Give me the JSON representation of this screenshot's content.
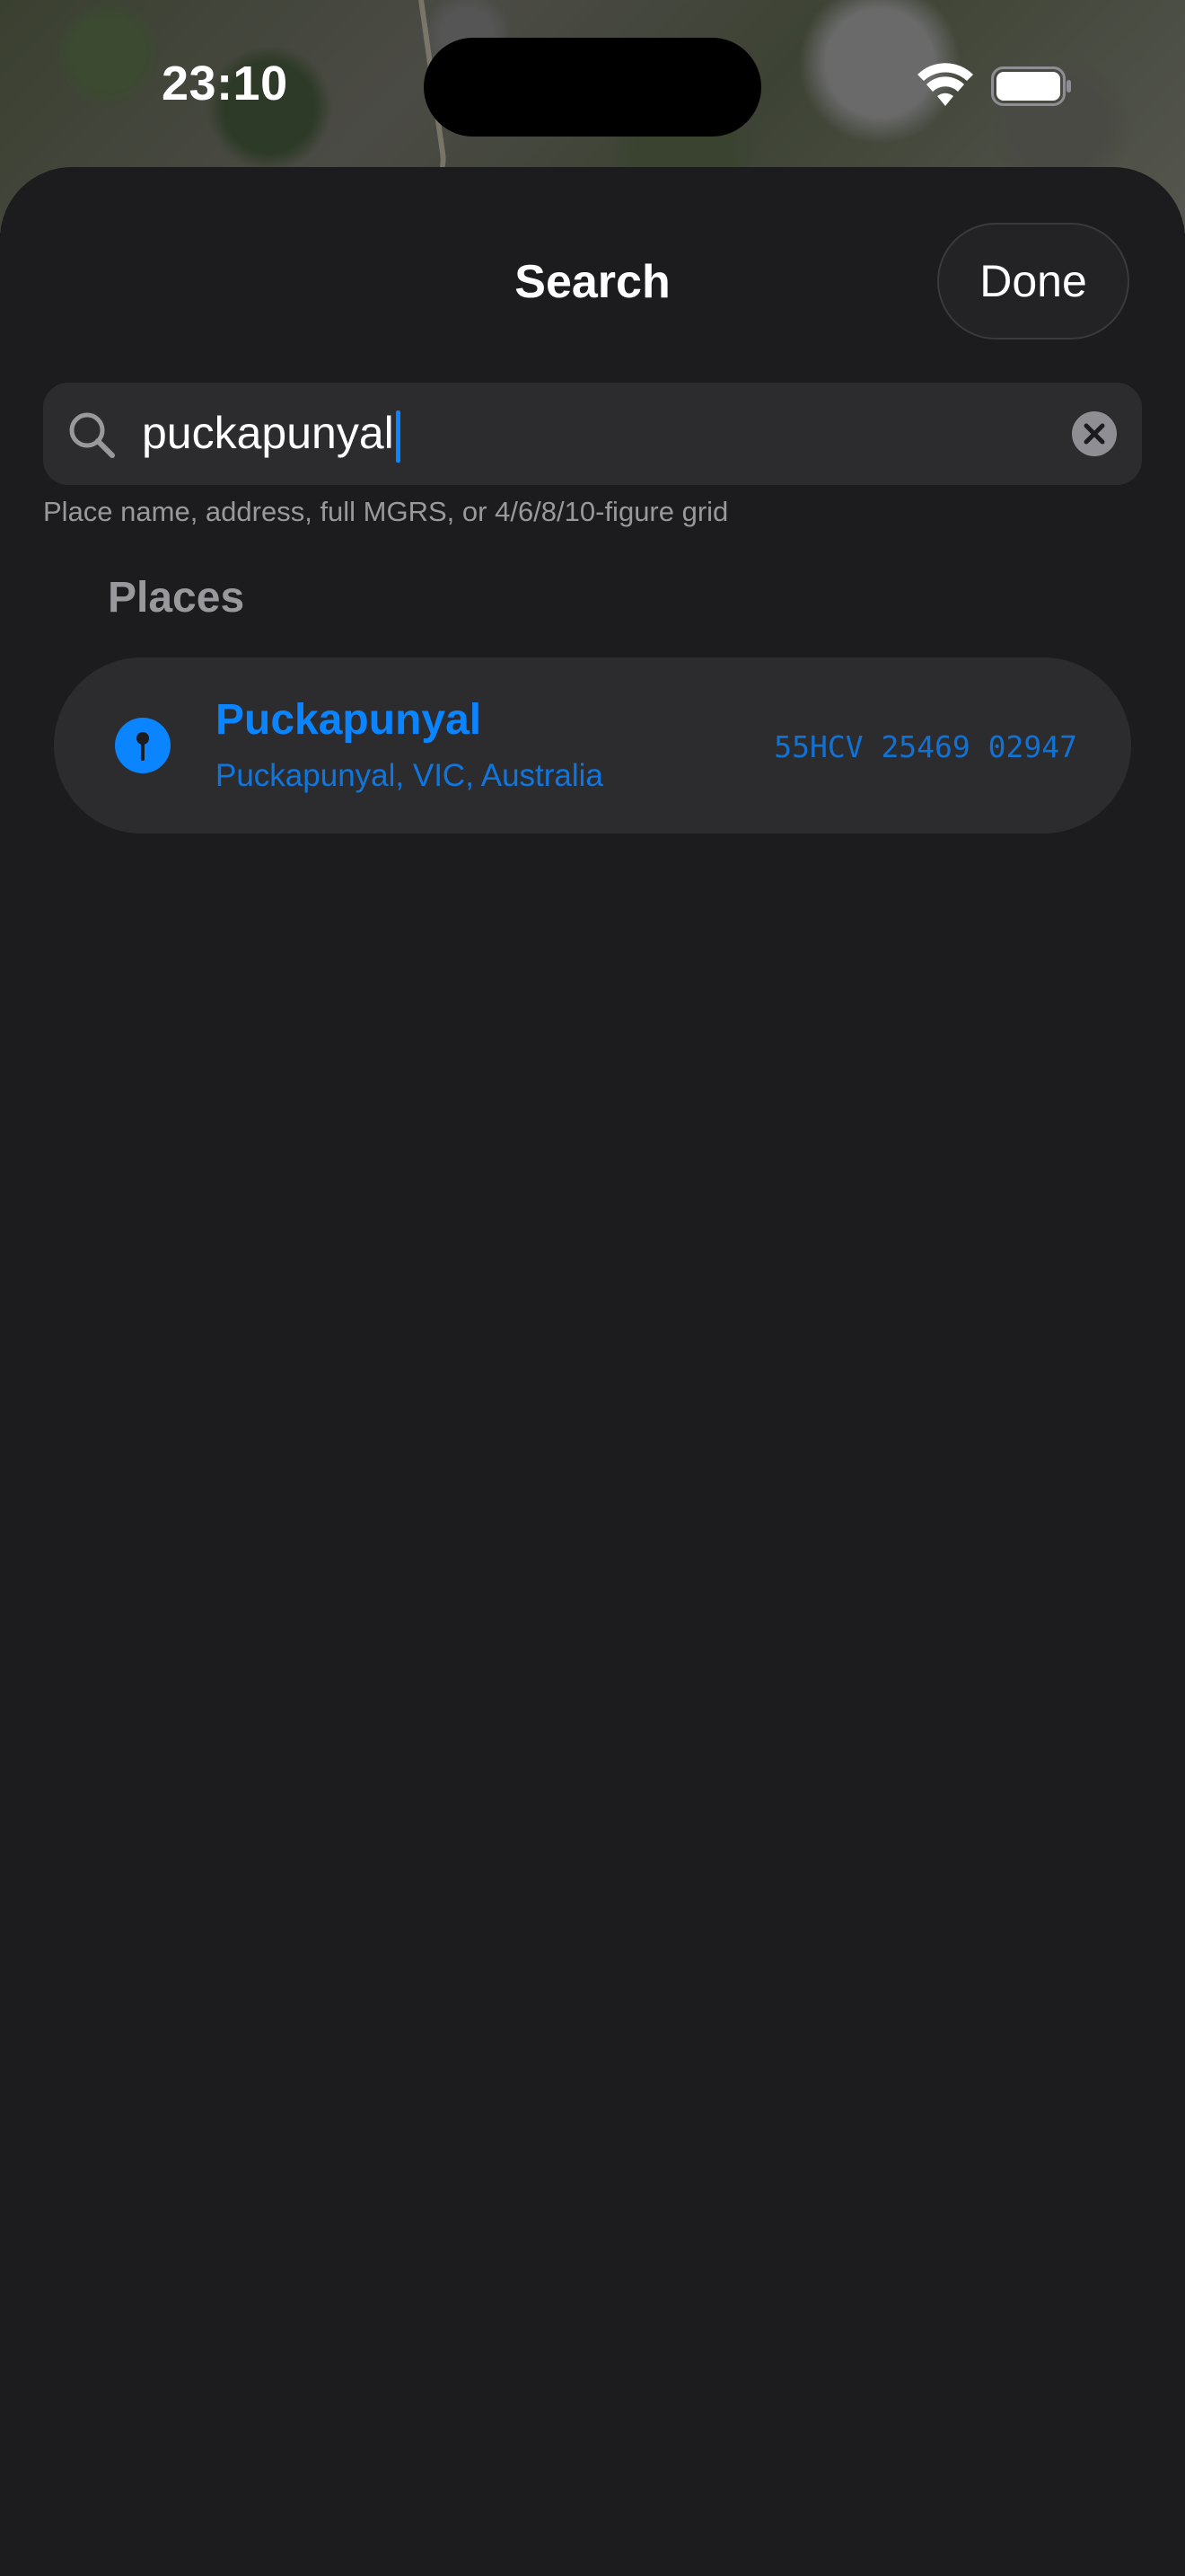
{
  "status_bar": {
    "time": "23:10",
    "icons": [
      "wifi-icon",
      "battery-icon"
    ]
  },
  "sheet": {
    "title": "Search",
    "done_label": "Done"
  },
  "search": {
    "value": "puckapunyal",
    "hint": "Place name, address, full MGRS, or 4/6/8/10-figure grid",
    "icons": [
      "search-icon",
      "clear-icon"
    ]
  },
  "results": {
    "section_label": "Places",
    "items": [
      {
        "title": "Puckapunyal",
        "subtitle": "Puckapunyal, VIC, Australia",
        "grid": "55HCV 25469 02947",
        "icon": "pin-icon"
      }
    ]
  },
  "colors": {
    "accent": "#0a84ff",
    "sheet_background": "#1c1c1e",
    "field_background": "#2c2c2e",
    "secondary_text": "#98989d"
  }
}
